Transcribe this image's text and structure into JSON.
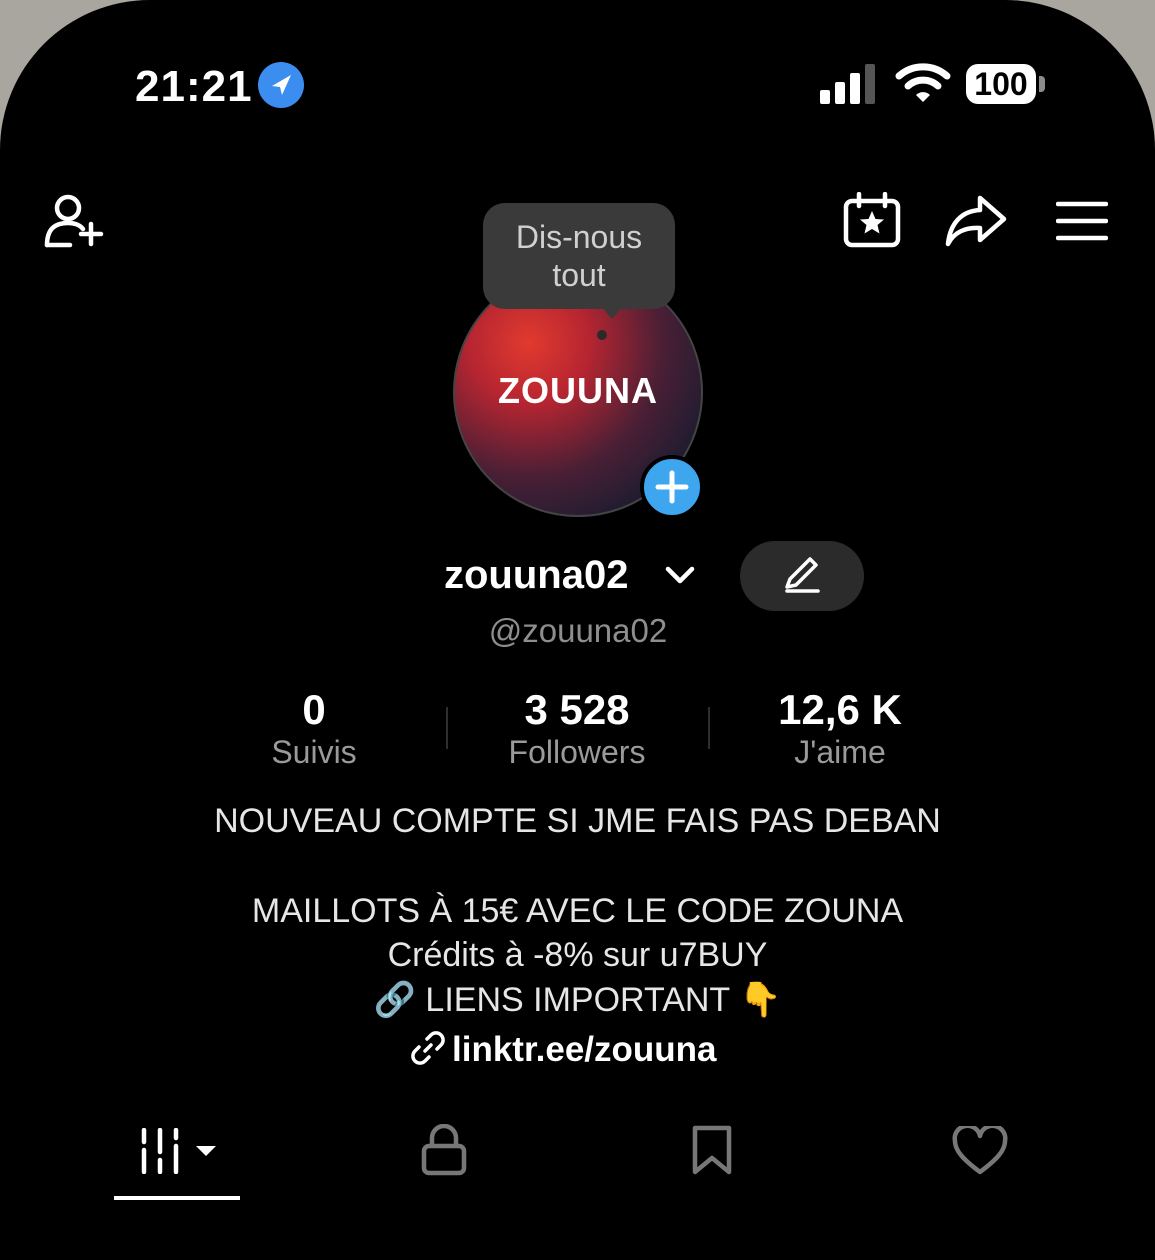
{
  "status_bar": {
    "time": "21:21",
    "battery": "100"
  },
  "tooltip": {
    "line1": "Dis-nous",
    "line2": "tout"
  },
  "avatar": {
    "text": "ZOUUNA"
  },
  "profile": {
    "display_name": "zouuna02",
    "handle": "@zouuna02"
  },
  "stats": [
    {
      "value": "0",
      "label": "Suivis"
    },
    {
      "value": "3 528",
      "label": "Followers"
    },
    {
      "value": "12,6 K",
      "label": "J'aime"
    }
  ],
  "bio": {
    "line1": "NOUVEAU COMPTE SI JME FAIS PAS DEBAN",
    "line2": "MAILLOTS À 15€ AVEC LE CODE ZOUNA",
    "line3": "Crédits à -8% sur u7BUY",
    "line4": "🔗 LIENS IMPORTANT 👇",
    "link": "linktr.ee/zouuna"
  },
  "icons": {
    "add_friend": "add-user-icon",
    "calendar": "calendar-star-icon",
    "share": "share-icon",
    "menu": "menu-icon",
    "grid": "videos-grid-icon",
    "lock": "lock-icon",
    "bookmark": "bookmark-icon",
    "heart": "heart-icon"
  },
  "colors": {
    "accent_blue": "#3ea6ee",
    "location_blue": "#3b8ef0",
    "background": "#000000"
  }
}
